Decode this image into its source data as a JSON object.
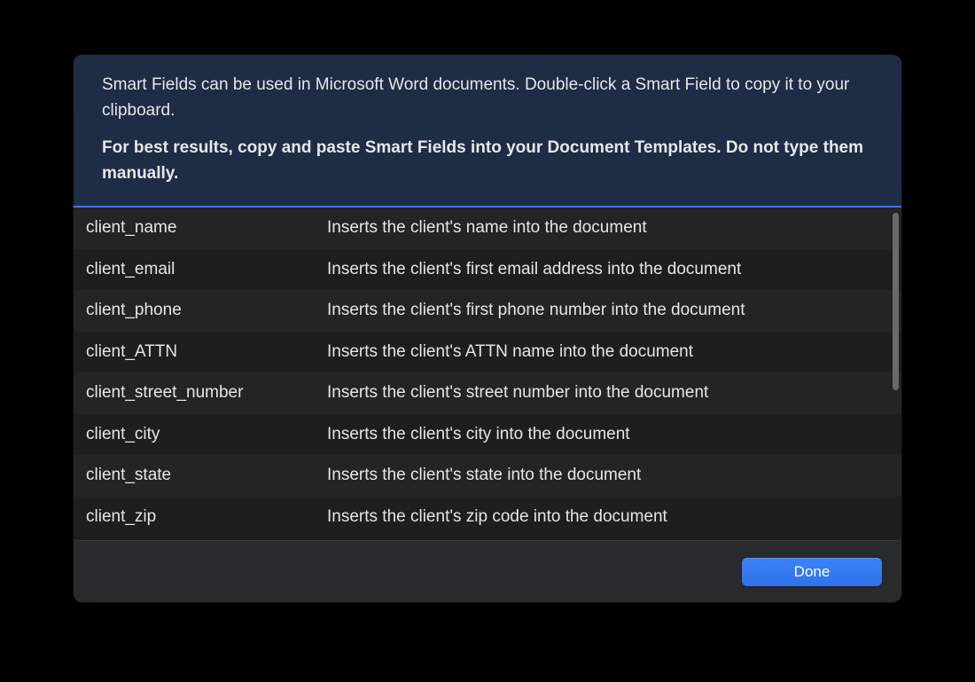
{
  "header": {
    "intro": "Smart Fields can be used in Microsoft Word documents. Double-click a Smart Field to copy it to your clipboard.",
    "warn": "For best results, copy and paste Smart Fields into your Document Templates. Do not type them manually."
  },
  "fields": [
    {
      "name": "client_name",
      "desc": "Inserts the client's name into the document"
    },
    {
      "name": "client_email",
      "desc": "Inserts the client's first email address into the document"
    },
    {
      "name": "client_phone",
      "desc": "Inserts the client's first phone number into the document"
    },
    {
      "name": "client_ATTN",
      "desc": "Inserts the client's ATTN name into the document"
    },
    {
      "name": "client_street_number",
      "desc": "Inserts the client's street number into the document"
    },
    {
      "name": "client_city",
      "desc": "Inserts the client's city into the document"
    },
    {
      "name": "client_state",
      "desc": "Inserts the client's state into the document"
    },
    {
      "name": "client_zip",
      "desc": "Inserts the client's zip code into the document"
    }
  ],
  "footer": {
    "done_label": "Done"
  }
}
